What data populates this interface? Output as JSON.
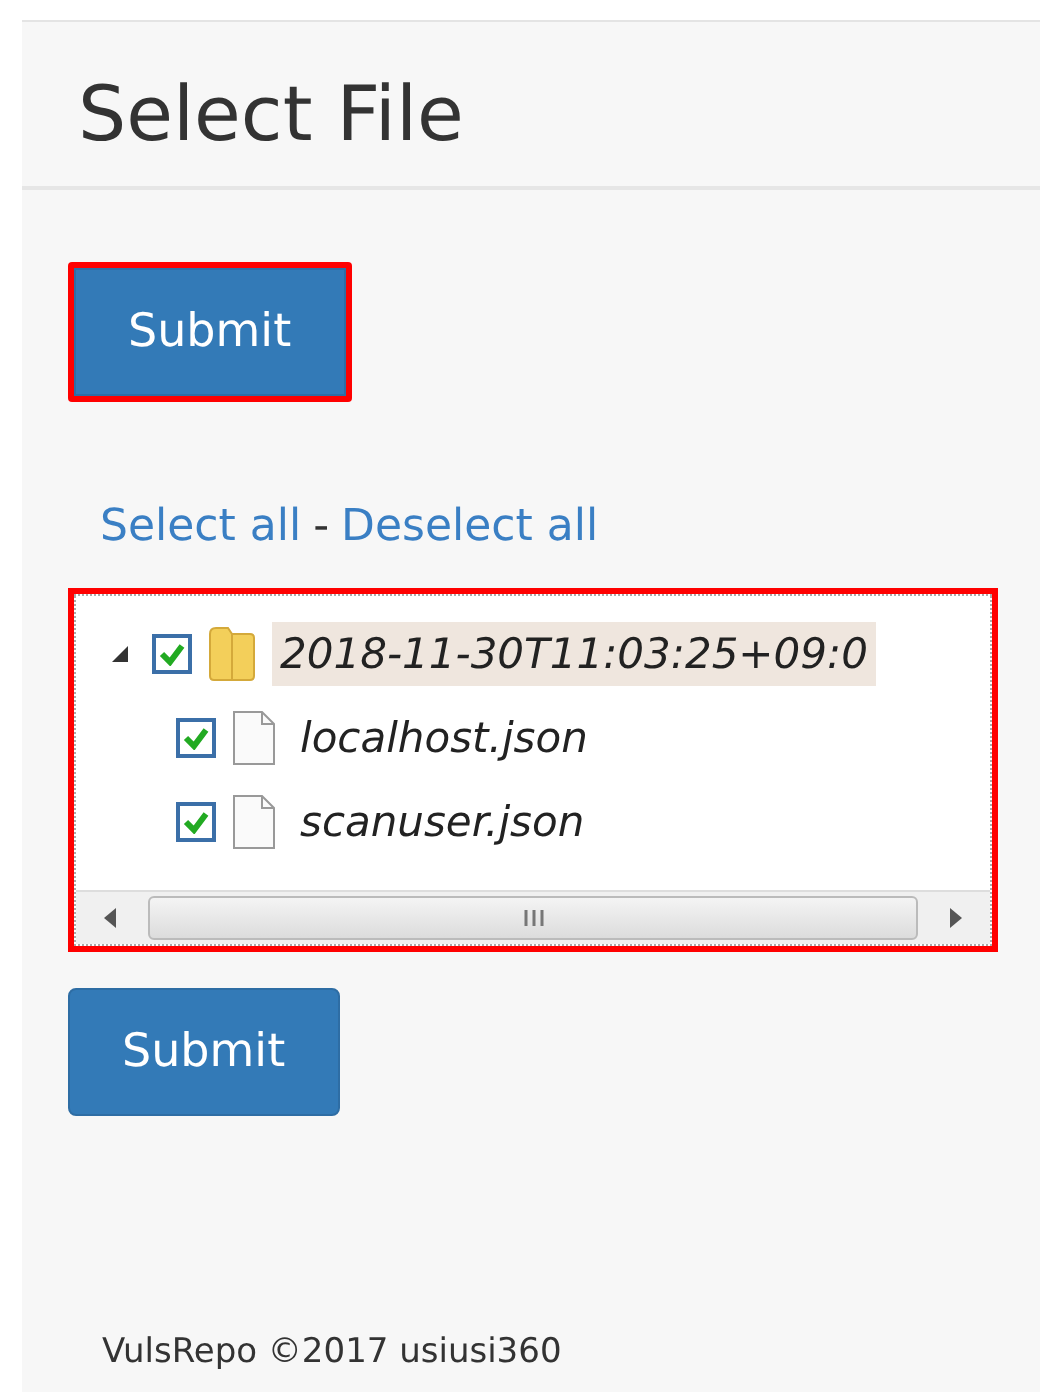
{
  "heading": "Select File",
  "submit_top": {
    "label": "Submit",
    "highlighted": true
  },
  "links": [
    {
      "label": "Select all"
    },
    {
      "label": "-",
      "kind": "separator"
    },
    {
      "label": "Deselect all"
    }
  ],
  "tree": {
    "highlighted": true,
    "nodes": [
      {
        "label": "2018-11-30T11:03:25+09:0",
        "kind": "folder",
        "checked": true,
        "expanded": true,
        "selected": true,
        "children": [
          {
            "label": "localhost.json",
            "kind": "file",
            "checked": true,
            "selected": false
          },
          {
            "label": "scanuser.json",
            "kind": "file",
            "checked": true,
            "selected": false
          }
        ]
      }
    ]
  },
  "submit_bottom": {
    "label": "Submit",
    "highlighted": false
  },
  "footer": "VulsRepo ©2017 usiusi360"
}
